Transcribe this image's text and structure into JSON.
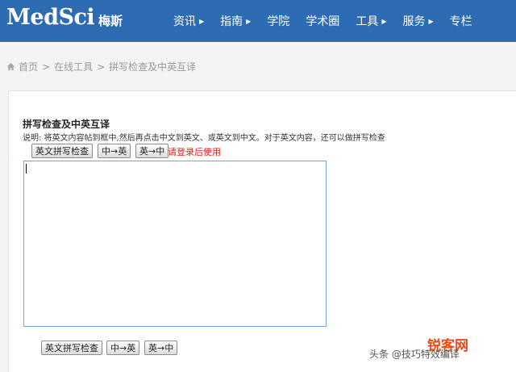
{
  "header": {
    "logo": "MedSci",
    "logo_cn": "梅斯",
    "nav": [
      {
        "label": "资讯",
        "has_caret": true
      },
      {
        "label": "指南",
        "has_caret": true
      },
      {
        "label": "学院",
        "has_caret": false
      },
      {
        "label": "学术圈",
        "has_caret": false
      },
      {
        "label": "工具",
        "has_caret": true
      },
      {
        "label": "服务",
        "has_caret": true
      },
      {
        "label": "专栏",
        "has_caret": false
      }
    ],
    "caret_glyph": "▶"
  },
  "breadcrumb": {
    "items": [
      "首页",
      "在线工具",
      "拼写检查及中英互译"
    ],
    "separator": ">"
  },
  "tool": {
    "title": "拼写检查及中英互译",
    "description": "说明: 将英文内容帖到框中,然后再点击中文到英文、或英文到中文。对于英文内容，还可以做拼写检查",
    "buttons_top": {
      "spell_check": "英文拼写检查",
      "zh_to_en": "中→英",
      "en_to_zh": "英→中"
    },
    "login_note": "请登录后使用",
    "textarea_value": "",
    "buttons_bottom": {
      "spell_check": "英文拼写检查",
      "zh_to_en": "中→英",
      "en_to_zh": "英→中"
    }
  },
  "watermark": {
    "logo_text": "锐客网",
    "caption": "头条 @技巧特效编译"
  },
  "colors": {
    "header_bg": "#2d6bb3",
    "login_note": "#e21b1b",
    "watermark": "#e84b1c"
  }
}
